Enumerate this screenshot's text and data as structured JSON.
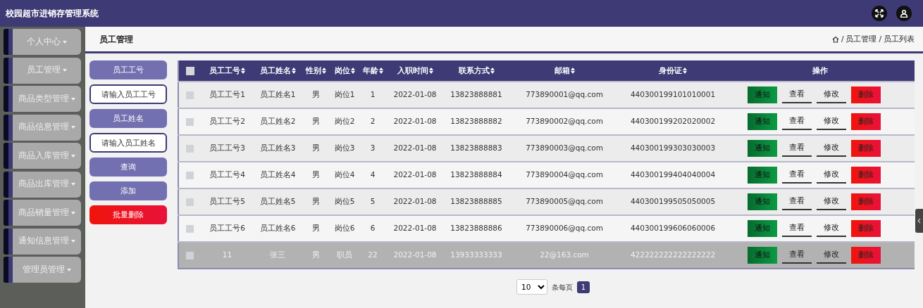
{
  "header": {
    "title": "校园超市进销存管理系统"
  },
  "sidebar": {
    "items": [
      {
        "label": "个人中心"
      },
      {
        "label": "员工管理"
      },
      {
        "label": "商品类型管理"
      },
      {
        "label": "商品信息管理"
      },
      {
        "label": "商品入库管理"
      },
      {
        "label": "商品出库管理"
      },
      {
        "label": "商品销量管理"
      },
      {
        "label": "通知信息管理"
      },
      {
        "label": "管理员管理"
      }
    ]
  },
  "page": {
    "title": "员工管理",
    "breadcrumb": [
      "员工管理",
      "员工列表"
    ],
    "separator": "/"
  },
  "filters": [
    {
      "label": "员工工号",
      "placeholder": "请输入员工工号"
    },
    {
      "label": "员工姓名",
      "placeholder": "请输入员工姓名"
    }
  ],
  "buttons": [
    {
      "label": "查询",
      "kind": "normal"
    },
    {
      "label": "添加",
      "kind": "normal"
    },
    {
      "label": "批量删除",
      "kind": "danger"
    }
  ],
  "table": {
    "select_all": {
      "checked": false
    },
    "columns": [
      {
        "label": "员工工号",
        "sortable": true
      },
      {
        "label": "员工姓名",
        "sortable": true
      },
      {
        "label": "性别",
        "sortable": true
      },
      {
        "label": "岗位",
        "sortable": true
      },
      {
        "label": "年龄",
        "sortable": true
      },
      {
        "label": "入职时间",
        "sortable": true
      },
      {
        "label": "联系方式",
        "sortable": true
      },
      {
        "label": "邮箱",
        "sortable": true
      },
      {
        "label": "身份证",
        "sortable": true
      },
      {
        "label": "操作",
        "sortable": false
      }
    ],
    "rows": [
      {
        "checked": false,
        "highlighted": false,
        "cells": [
          "员工工号1",
          "员工姓名1",
          "男",
          "岗位1",
          "1",
          "2022-01-08",
          "13823888881",
          "773890001@qq.com",
          "440300199101010001"
        ],
        "actions": [
          {
            "label": "通知",
            "kind": "success"
          },
          {
            "label": "查看",
            "kind": "plain"
          },
          {
            "label": "修改",
            "kind": "plain"
          },
          {
            "label": "删除",
            "kind": "danger"
          }
        ]
      },
      {
        "checked": false,
        "highlighted": false,
        "cells": [
          "员工工号2",
          "员工姓名2",
          "男",
          "岗位2",
          "2",
          "2022-01-08",
          "13823888882",
          "773890002@qq.com",
          "440300199202020002"
        ],
        "actions": [
          {
            "label": "通知",
            "kind": "success"
          },
          {
            "label": "查看",
            "kind": "plain"
          },
          {
            "label": "修改",
            "kind": "plain"
          },
          {
            "label": "删除",
            "kind": "danger"
          }
        ]
      },
      {
        "checked": false,
        "highlighted": false,
        "cells": [
          "员工工号3",
          "员工姓名3",
          "男",
          "岗位3",
          "3",
          "2022-01-08",
          "13823888883",
          "773890003@qq.com",
          "440300199303030003"
        ],
        "actions": [
          {
            "label": "通知",
            "kind": "success"
          },
          {
            "label": "查看",
            "kind": "plain"
          },
          {
            "label": "修改",
            "kind": "plain"
          },
          {
            "label": "删除",
            "kind": "danger"
          }
        ]
      },
      {
        "checked": false,
        "highlighted": false,
        "cells": [
          "员工工号4",
          "员工姓名4",
          "男",
          "岗位4",
          "4",
          "2022-01-08",
          "13823888884",
          "773890004@qq.com",
          "440300199404040004"
        ],
        "actions": [
          {
            "label": "通知",
            "kind": "success"
          },
          {
            "label": "查看",
            "kind": "plain"
          },
          {
            "label": "修改",
            "kind": "plain"
          },
          {
            "label": "删除",
            "kind": "danger"
          }
        ]
      },
      {
        "checked": false,
        "highlighted": false,
        "cells": [
          "员工工号5",
          "员工姓名5",
          "男",
          "岗位5",
          "5",
          "2022-01-08",
          "13823888885",
          "773890005@qq.com",
          "440300199505050005"
        ],
        "actions": [
          {
            "label": "通知",
            "kind": "success"
          },
          {
            "label": "查看",
            "kind": "plain"
          },
          {
            "label": "修改",
            "kind": "plain"
          },
          {
            "label": "删除",
            "kind": "danger"
          }
        ]
      },
      {
        "checked": false,
        "highlighted": false,
        "cells": [
          "员工工号6",
          "员工姓名6",
          "男",
          "岗位6",
          "6",
          "2022-01-08",
          "13823888886",
          "773890006@qq.com",
          "440300199606060006"
        ],
        "actions": [
          {
            "label": "通知",
            "kind": "success"
          },
          {
            "label": "查看",
            "kind": "plain"
          },
          {
            "label": "修改",
            "kind": "plain"
          },
          {
            "label": "删除",
            "kind": "danger"
          }
        ]
      },
      {
        "checked": false,
        "highlighted": true,
        "cells": [
          "11",
          "张三",
          "男",
          "职员",
          "22",
          "2022-01-08",
          "13933333333",
          "22@163.com",
          "422222222222222222"
        ],
        "actions": [
          {
            "label": "通知",
            "kind": "success"
          },
          {
            "label": "查看",
            "kind": "plain"
          },
          {
            "label": "修改",
            "kind": "plain"
          },
          {
            "label": "删除",
            "kind": "danger"
          }
        ]
      }
    ]
  },
  "pagination": {
    "page_size": "10",
    "page_size_label": "条每页",
    "pages": [
      {
        "label": "1",
        "selected": true
      }
    ]
  }
}
